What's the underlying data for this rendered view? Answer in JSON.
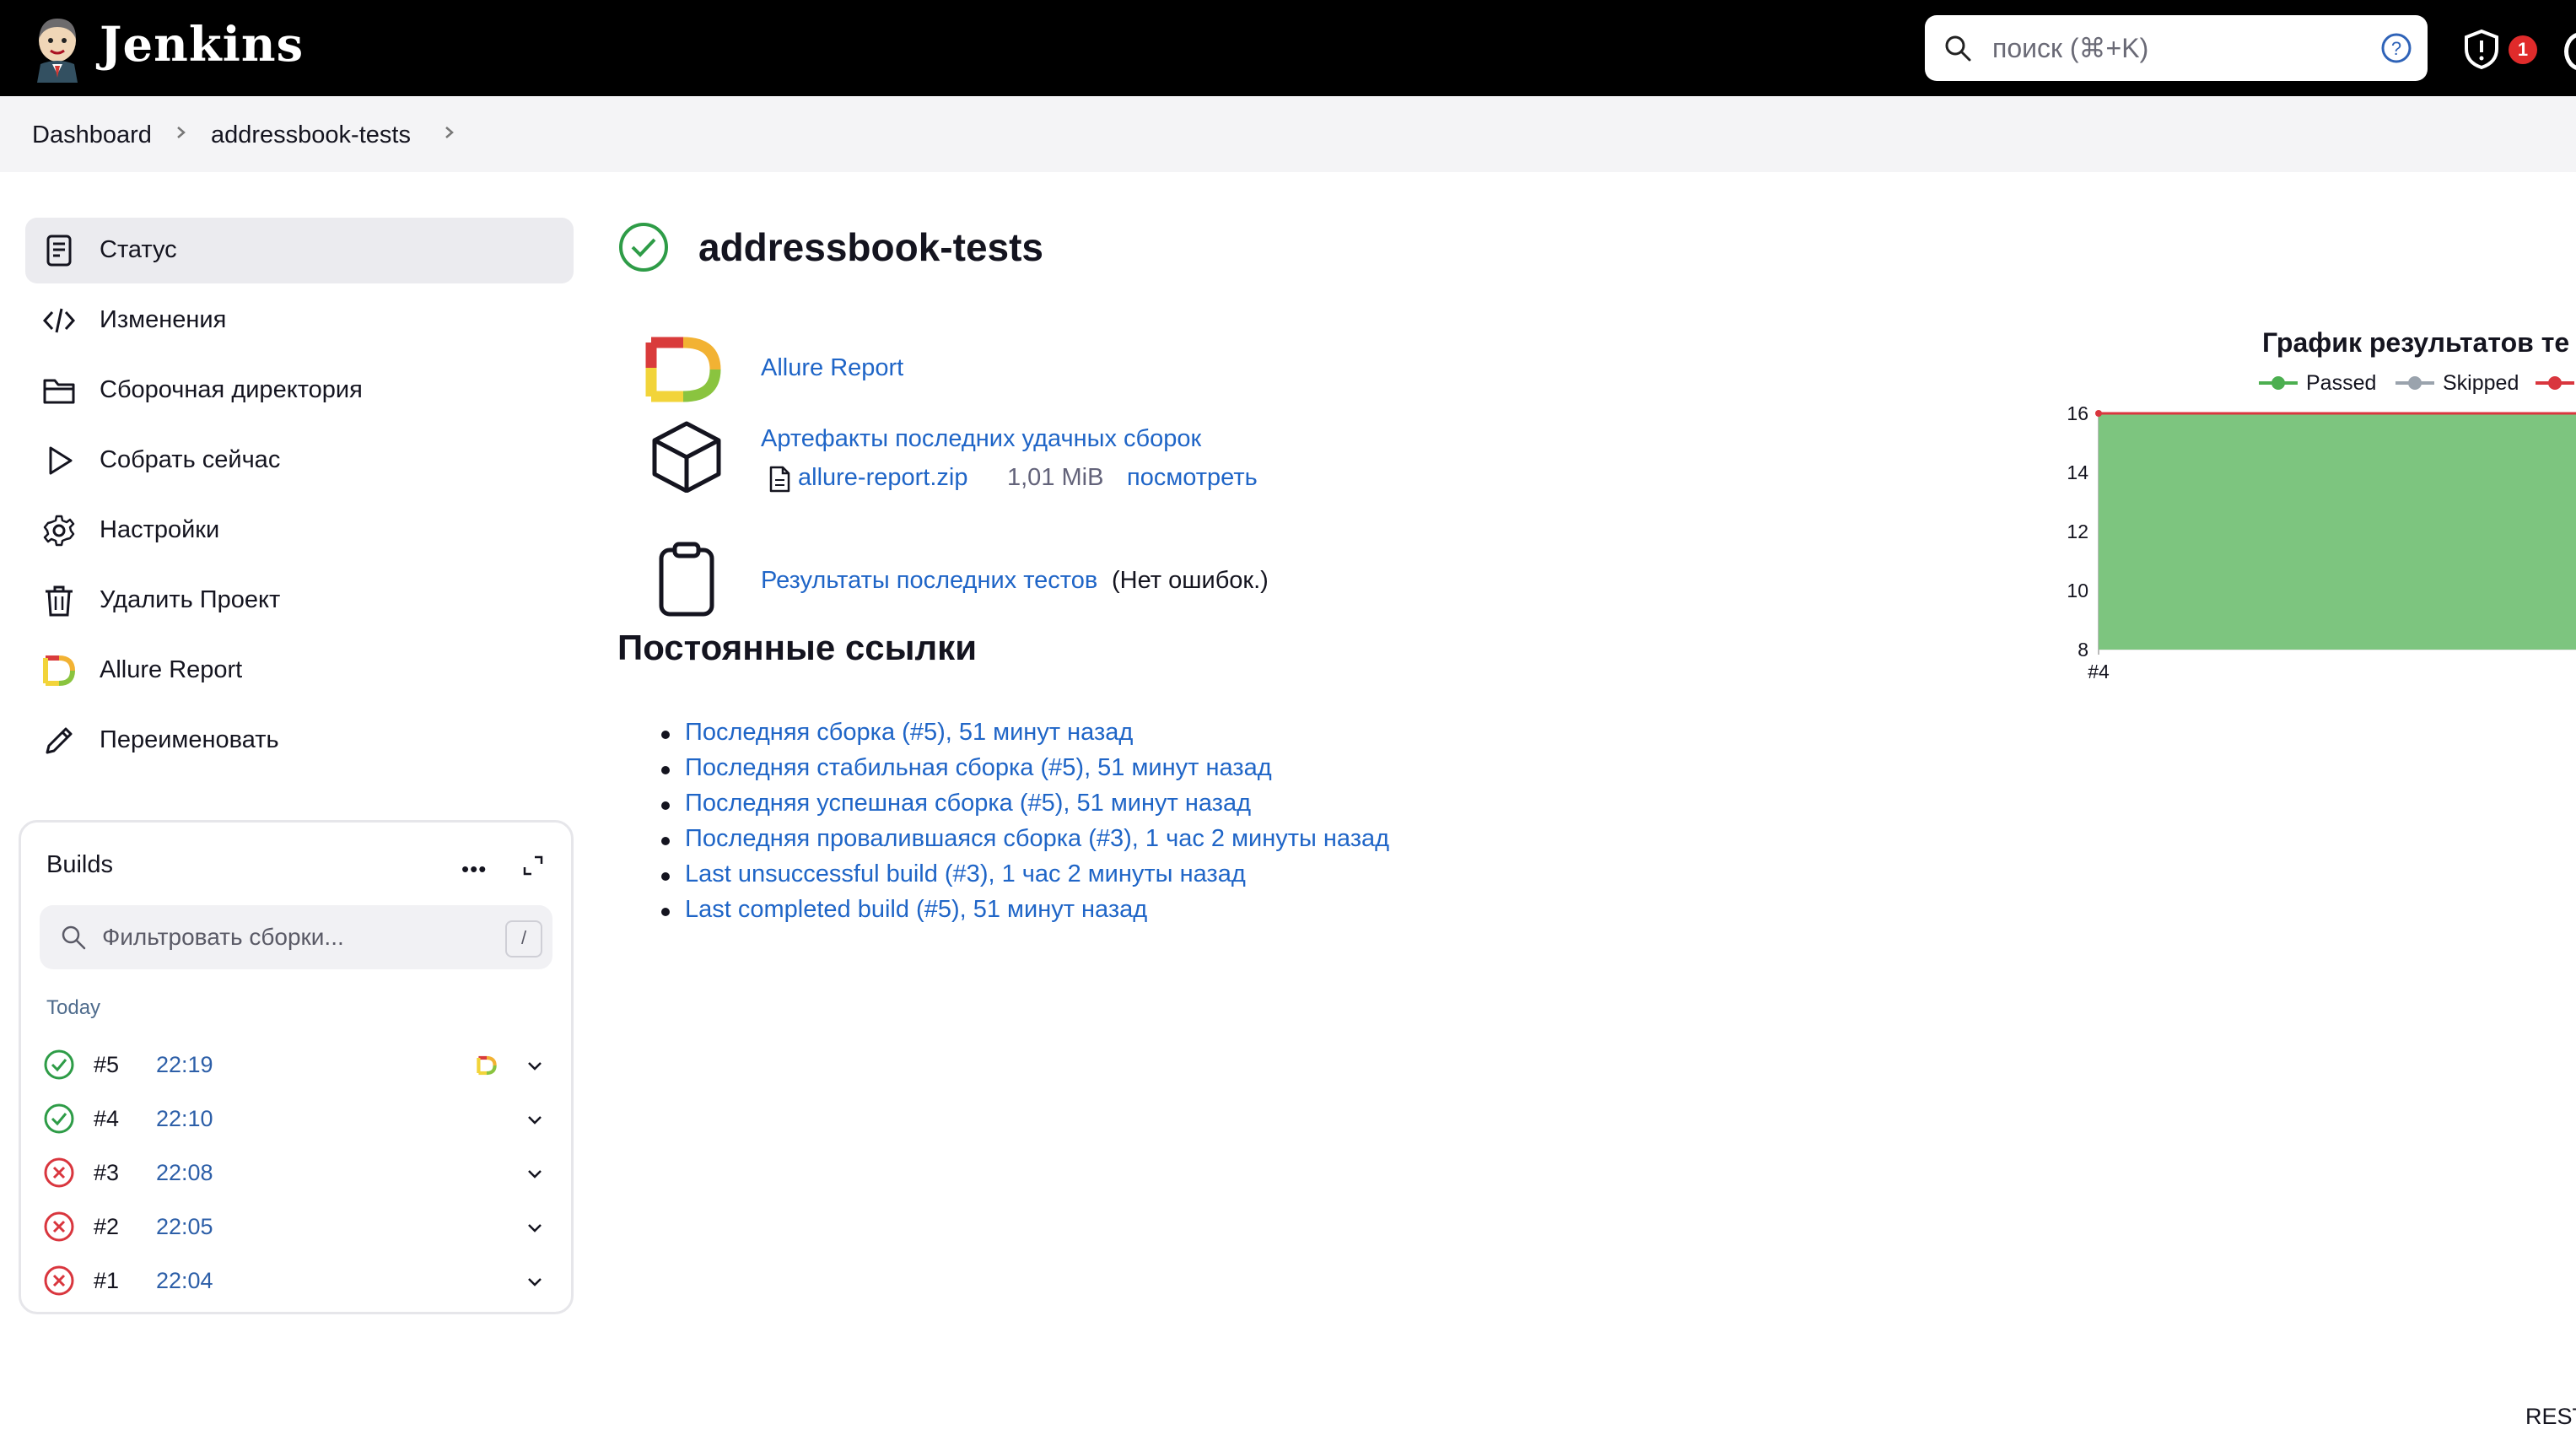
{
  "header": {
    "app_name": "Jenkins",
    "search_placeholder": "поиск (⌘+K)",
    "notifications_count": "1"
  },
  "breadcrumb": [
    "Dashboard",
    "addressbook-tests"
  ],
  "sidebar": {
    "items": [
      {
        "label": "Статус",
        "icon": "status-icon",
        "active": true
      },
      {
        "label": "Изменения",
        "icon": "code-icon"
      },
      {
        "label": "Сборочная директория",
        "icon": "folder-icon"
      },
      {
        "label": "Собрать сейчас",
        "icon": "play-icon"
      },
      {
        "label": "Настройки",
        "icon": "gear-icon"
      },
      {
        "label": "Удалить Проект",
        "icon": "trash-icon"
      },
      {
        "label": "Allure Report",
        "icon": "allure-icon"
      },
      {
        "label": "Переименовать",
        "icon": "pencil-icon"
      }
    ]
  },
  "builds_panel": {
    "title": "Builds",
    "more_label": "•••",
    "filter_placeholder": "Фильтровать сборки...",
    "filter_shortcut": "/",
    "group_label": "Today",
    "builds": [
      {
        "number": "#5",
        "time": "22:19",
        "status": "success",
        "has_allure": true
      },
      {
        "number": "#4",
        "time": "22:10",
        "status": "success",
        "has_allure": false
      },
      {
        "number": "#3",
        "time": "22:08",
        "status": "failed",
        "has_allure": false
      },
      {
        "number": "#2",
        "time": "22:05",
        "status": "failed",
        "has_allure": false
      },
      {
        "number": "#1",
        "time": "22:04",
        "status": "failed",
        "has_allure": false
      }
    ]
  },
  "main": {
    "title": "addressbook-tests",
    "allure_link": "Allure Report",
    "artifacts_title": "Артефакты последних удачных сборок",
    "artifact": {
      "name": "allure-report.zip",
      "size": "1,01 MiB",
      "view_label": "посмотреть"
    },
    "test_results_link": "Результаты последних тестов",
    "test_results_note": "(Нет ошибок.)",
    "permalinks_title": "Постоянные ссылки",
    "permalinks": [
      "Последняя сборка (#5), 51 минут назад",
      "Последняя стабильная сборка (#5), 51 минут назад",
      "Последняя успешная сборка (#5), 51 минут назад",
      "Последняя провалившаяся сборка (#3), 1 час 2 минуты назад",
      "Last unsuccessful build (#3), 1 час 2 минуты назад",
      "Last completed build (#5), 51 минут назад"
    ]
  },
  "footer": {
    "rest_label": "REST"
  },
  "colors": {
    "passed": "#4caf50",
    "skipped": "#9aa3ad",
    "failed": "#d9363e",
    "link": "#1f65c7"
  },
  "chart_data": {
    "type": "area",
    "title": "График результатов те",
    "legend": [
      "Passed",
      "Skipped"
    ],
    "x": [
      "#4"
    ],
    "y_ticks": [
      "16",
      "14",
      "12",
      "10",
      "8"
    ],
    "ylim": [
      8,
      16
    ],
    "series": [
      {
        "name": "Passed",
        "values": [
          16
        ]
      }
    ],
    "legend_position": "top"
  }
}
